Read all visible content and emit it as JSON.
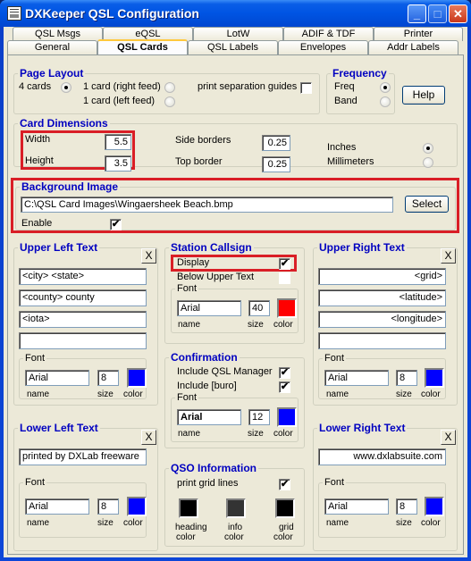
{
  "window": {
    "title": "DXKeeper QSL Configuration",
    "minimize": "_",
    "maximize": "□",
    "close": "✕"
  },
  "tabs": {
    "row1": [
      "QSL Msgs",
      "eQSL",
      "LotW",
      "ADIF & TDF",
      "Printer"
    ],
    "row2": [
      "General",
      "QSL Cards",
      "QSL Labels",
      "Envelopes",
      "Addr Labels"
    ],
    "active": "QSL Cards"
  },
  "page_layout": {
    "title": "Page Layout",
    "four_cards": "4 cards",
    "one_right": "1 card (right feed)",
    "one_left": "1 card (left feed)",
    "selected": "4 cards",
    "guides_label": "print separation guides",
    "guides_checked": false
  },
  "frequency": {
    "title": "Frequency",
    "freq": "Freq",
    "band": "Band",
    "selected": "Freq"
  },
  "help_button": "Help",
  "card_dimensions": {
    "title": "Card Dimensions",
    "width_label": "Width",
    "width": "5.5",
    "height_label": "Height",
    "height": "3.5",
    "side_label": "Side borders",
    "side": "0.25",
    "top_label": "Top border",
    "top": "0.25",
    "inches": "Inches",
    "mm": "Millimeters",
    "selected": "Inches"
  },
  "background": {
    "title": "Background Image",
    "path": "C:\\QSL Card Images\\Wingaersheek Beach.bmp",
    "select": "Select",
    "enable_label": "Enable",
    "enable_checked": true,
    "check": "✔"
  },
  "upper_left": {
    "title": "Upper Left Text",
    "lines": [
      "<city> <state>",
      "<county> county",
      "<iota>",
      ""
    ],
    "font": {
      "title": "Font",
      "name": "Arial",
      "size": "8",
      "color": "#0000ff",
      "name_label": "name",
      "size_label": "size",
      "color_label": "color"
    }
  },
  "station_callsign": {
    "title": "Station Callsign",
    "display_label": "Display",
    "display_checked": true,
    "below_label": "Below Upper Text",
    "below_checked": false,
    "font": {
      "title": "Font",
      "name": "Arial",
      "size": "40",
      "color": "#ff0000",
      "name_label": "name",
      "size_label": "size",
      "color_label": "color"
    }
  },
  "confirmation": {
    "title": "Confirmation",
    "qsl_mgr_label": "Include QSL Manager",
    "qsl_mgr_checked": true,
    "buro_label": "Include [buro]",
    "buro_checked": true,
    "font": {
      "title": "Font",
      "name": "Arial",
      "size": "12",
      "color": "#0000ff",
      "name_label": "name",
      "size_label": "size",
      "color_label": "color"
    }
  },
  "qso_info": {
    "title": "QSO Information",
    "grid_label": "print grid lines",
    "grid_checked": true,
    "heading_color": "#000000",
    "info_color": "#333333",
    "grid_color": "#000000",
    "heading_label_1": "heading",
    "info_label_1": "info",
    "grid_label_1": "grid",
    "color_word": "color"
  },
  "upper_right": {
    "title": "Upper Right Text",
    "lines": [
      "<grid>",
      "<latitude>",
      "<longitude>",
      ""
    ],
    "font": {
      "title": "Font",
      "name": "Arial",
      "size": "8",
      "color": "#0000ff",
      "name_label": "name",
      "size_label": "size",
      "color_label": "color"
    }
  },
  "lower_left": {
    "title": "Lower Left Text",
    "lines": [
      "printed by DXLab freeware"
    ],
    "font": {
      "title": "Font",
      "name": "Arial",
      "size": "8",
      "color": "#0000ff",
      "name_label": "name",
      "size_label": "size",
      "color_label": "color"
    }
  },
  "lower_right": {
    "title": "Lower Right Text",
    "lines": [
      "www.dxlabsuite.com"
    ],
    "font": {
      "title": "Font",
      "name": "Arial",
      "size": "8",
      "color": "#0000ff",
      "name_label": "name",
      "size_label": "size",
      "color_label": "color"
    }
  },
  "clear_glyph": "X",
  "highlight_color": "#d91e26"
}
